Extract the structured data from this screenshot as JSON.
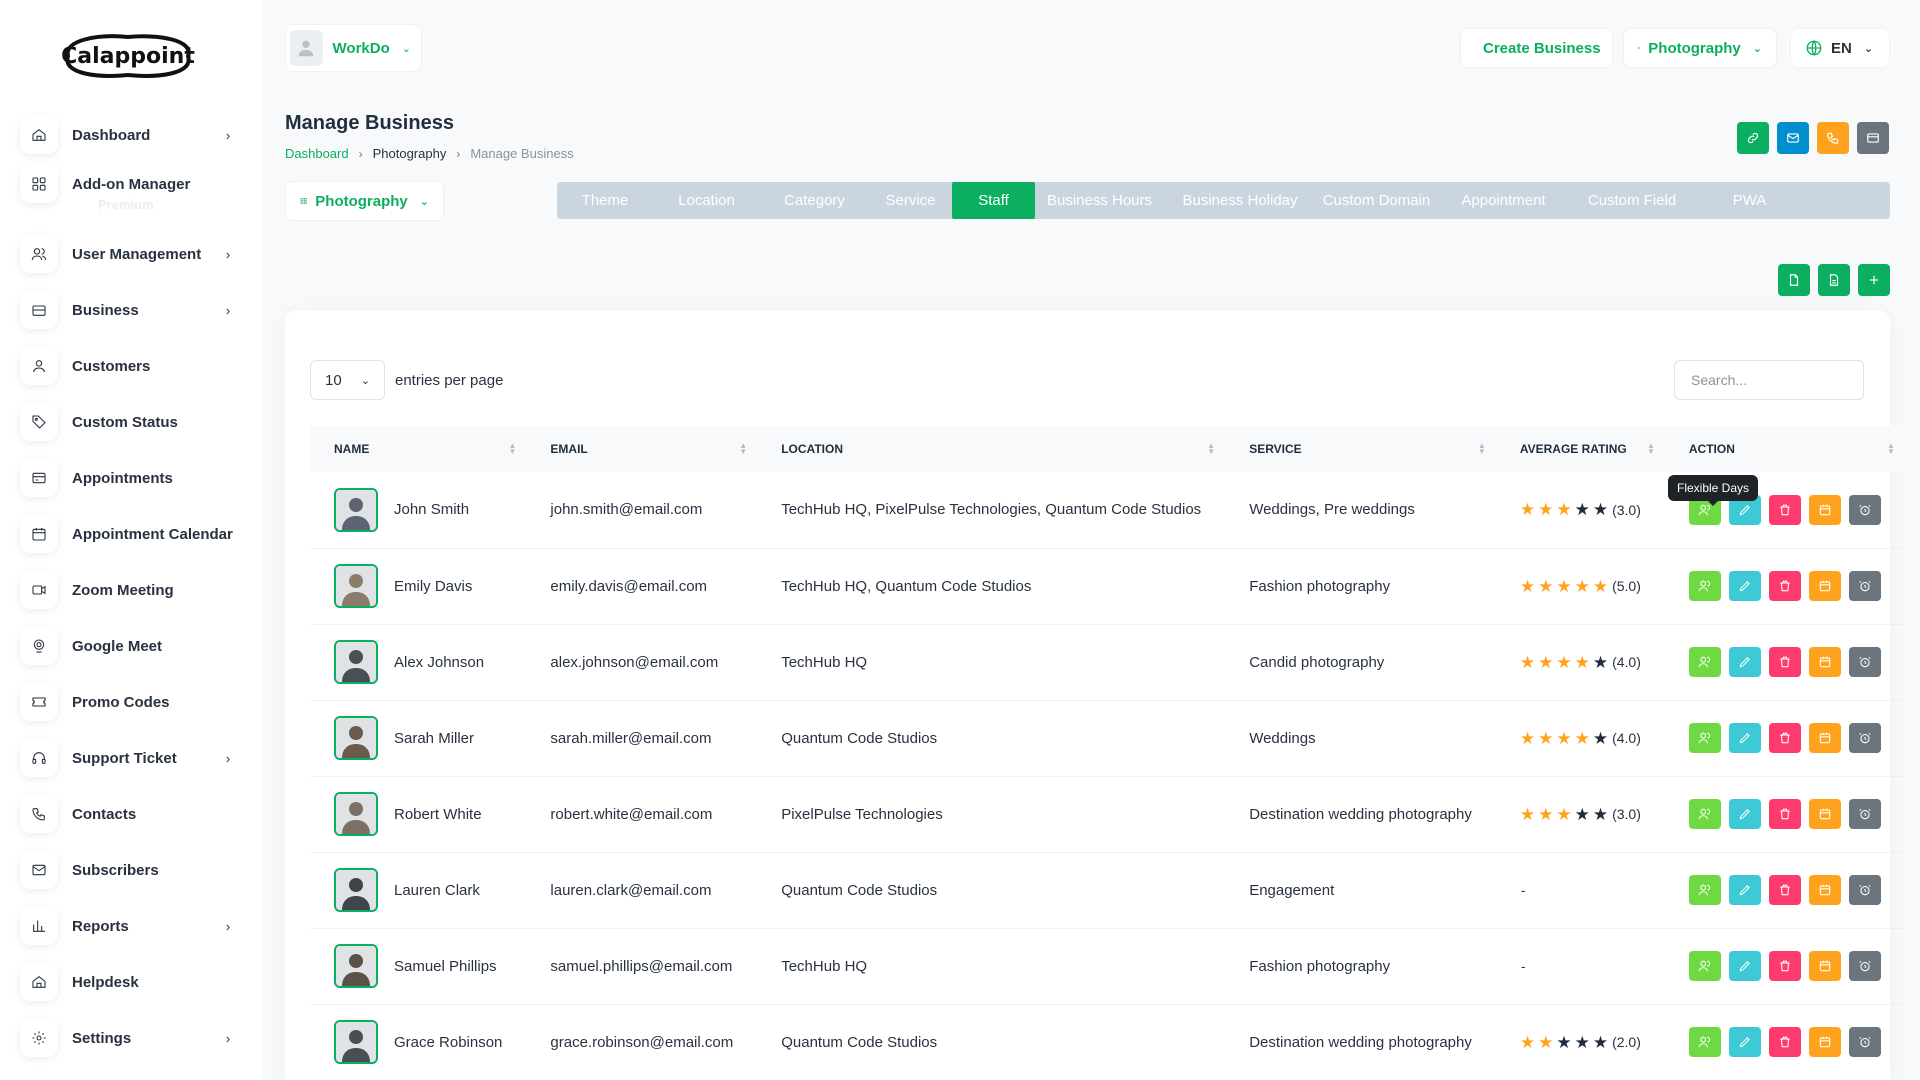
{
  "brand": {
    "logo_text": "Calappoint"
  },
  "sidebar": {
    "items": [
      {
        "label": "Dashboard",
        "icon": "home-icon",
        "has_submenu": true
      },
      {
        "label": "Add-on Manager",
        "icon": "grid-icon",
        "has_submenu": false,
        "sub_label": "Premium"
      },
      {
        "label": "User Management",
        "icon": "users-icon",
        "has_submenu": true
      },
      {
        "label": "Business",
        "icon": "briefcase-icon",
        "has_submenu": true
      },
      {
        "label": "Customers",
        "icon": "user-icon",
        "has_submenu": false
      },
      {
        "label": "Custom Status",
        "icon": "tag-icon",
        "has_submenu": false
      },
      {
        "label": "Appointments",
        "icon": "card-icon",
        "has_submenu": false
      },
      {
        "label": "Appointment Calendar",
        "icon": "calendar-icon",
        "has_submenu": false
      },
      {
        "label": "Zoom Meeting",
        "icon": "video-icon",
        "has_submenu": false
      },
      {
        "label": "Google Meet",
        "icon": "webcam-icon",
        "has_submenu": false
      },
      {
        "label": "Promo Codes",
        "icon": "ticket-icon",
        "has_submenu": false
      },
      {
        "label": "Support Ticket",
        "icon": "headset-icon",
        "has_submenu": true
      },
      {
        "label": "Contacts",
        "icon": "phone-icon",
        "has_submenu": false
      },
      {
        "label": "Subscribers",
        "icon": "mail-icon",
        "has_submenu": false
      },
      {
        "label": "Reports",
        "icon": "bar-chart-icon",
        "has_submenu": true
      },
      {
        "label": "Helpdesk",
        "icon": "home-icon",
        "has_submenu": false
      },
      {
        "label": "Settings",
        "icon": "gear-icon",
        "has_submenu": true
      }
    ]
  },
  "header": {
    "user_name": "WorkDo",
    "create_business": "Create Business",
    "business_selector": "Photography",
    "language": "EN"
  },
  "page": {
    "title": "Manage Business",
    "breadcrumb": [
      "Dashboard",
      "Photography",
      "Manage Business"
    ],
    "business_dropdown": "Photography"
  },
  "tabs": [
    {
      "label": "Theme",
      "active": false
    },
    {
      "label": "Location",
      "active": false
    },
    {
      "label": "Category",
      "active": false
    },
    {
      "label": "Service",
      "active": false
    },
    {
      "label": "Staff",
      "active": true
    },
    {
      "label": "Business Hours",
      "active": false
    },
    {
      "label": "Business Holiday",
      "active": false
    },
    {
      "label": "Custom Domain",
      "active": false
    },
    {
      "label": "Appointment",
      "active": false
    },
    {
      "label": "Custom Field",
      "active": false
    },
    {
      "label": "PWA",
      "active": false
    }
  ],
  "table_controls": {
    "entries_value": "10",
    "entries_label": "entries per page",
    "search_placeholder": "Search..."
  },
  "table": {
    "columns": [
      "NAME",
      "EMAIL",
      "LOCATION",
      "SERVICE",
      "AVERAGE RATING",
      "ACTION"
    ],
    "rows": [
      {
        "name": "John Smith",
        "email": "john.smith@email.com",
        "location": "TechHub HQ, PixelPulse Technologies, Quantum Code Studios",
        "service": "Weddings, Pre weddings",
        "rating": 3,
        "rating_label": "(3.0)"
      },
      {
        "name": "Emily Davis",
        "email": "emily.davis@email.com",
        "location": "TechHub HQ, Quantum Code Studios",
        "service": "Fashion photography",
        "rating": 5,
        "rating_label": "(5.0)"
      },
      {
        "name": "Alex Johnson",
        "email": "alex.johnson@email.com",
        "location": "TechHub HQ",
        "service": "Candid photography",
        "rating": 4,
        "rating_label": "(4.0)"
      },
      {
        "name": "Sarah Miller",
        "email": "sarah.miller@email.com",
        "location": "Quantum Code Studios",
        "service": "Weddings",
        "rating": 4,
        "rating_label": "(4.0)"
      },
      {
        "name": "Robert White",
        "email": "robert.white@email.com",
        "location": "PixelPulse Technologies",
        "service": "Destination wedding photography",
        "rating": 3,
        "rating_label": "(3.0)"
      },
      {
        "name": "Lauren Clark",
        "email": "lauren.clark@email.com",
        "location": "Quantum Code Studios",
        "service": "Engagement",
        "rating": null,
        "rating_label": "-"
      },
      {
        "name": "Samuel Phillips",
        "email": "samuel.phillips@email.com",
        "location": "TechHub HQ",
        "service": "Fashion photography",
        "rating": null,
        "rating_label": "-"
      },
      {
        "name": "Grace Robinson",
        "email": "grace.robinson@email.com",
        "location": "Quantum Code Studios",
        "service": "Destination wedding photography",
        "rating": 2,
        "rating_label": "(2.0)"
      }
    ]
  },
  "tooltip": "Flexible Days",
  "colors": {
    "primary": "#0caf60",
    "info": "#008ecc",
    "warning": "#ffa21d",
    "danger": "#ff3a6e",
    "cyan": "#3ec9d6",
    "lime": "#6fd943",
    "gray": "#6c757d",
    "tab_bg": "#cbd5df"
  }
}
